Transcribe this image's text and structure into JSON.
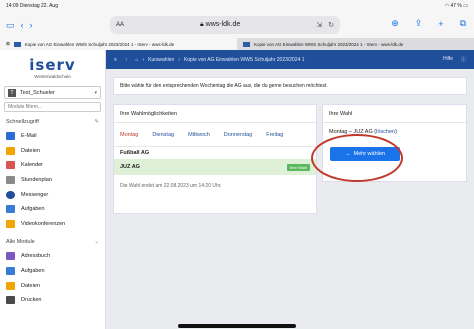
{
  "status": {
    "time_date": "14:09  Dienstag 22. Aug",
    "battery": "47 %"
  },
  "browser": {
    "reader": "AA",
    "url": "wws-ldk.de"
  },
  "tabs": [
    {
      "label": "Kopie von AG Einwahlen WWS Schuljahr 2023/2024 1 - IServ - wws-ldk.de"
    },
    {
      "label": "Kopie von AG Einwahlen WWS Schuljahr 2023/2024 1 - IServ - wws-ldk.de"
    }
  ],
  "sidebar": {
    "logo": "iserv",
    "school": "Westerwaldschule",
    "user_initial": "T",
    "user": "Test_Schueler",
    "search_placeholder": "Module filtern...",
    "quick_access": "Schnellzugriff",
    "items": [
      "E-Mail",
      "Dateien",
      "Kalender",
      "Stundenplan",
      "Messenger",
      "Aufgaben",
      "Videokonferenzen"
    ],
    "all_modules": "Alle Module",
    "modules": [
      "Adressbuch",
      "Aufgaben",
      "Dateien",
      "Drucken"
    ]
  },
  "header": {
    "breadcrumb": [
      "Kurswahlen",
      "Kopie von AG Einwahlen WWS Schuljahr 2023/2024 1"
    ],
    "help": "Hilfe"
  },
  "notice": "Bitte wähle für den entsprechenden Wochentag die AG aus, die du gerne besuchen möchtest.",
  "left_card": {
    "title": "Ihre Wahlmöglichkeiten",
    "days": [
      "Montag",
      "Dienstag",
      "Mittwoch",
      "Donnerstag",
      "Freitag"
    ],
    "group": "Fußball AG",
    "course": "JUZ AG",
    "course_badge": "Ihre Wahl",
    "end": "Die Wahl endet am 22.08.2023 um 14:20 Uhr."
  },
  "right_card": {
    "title": "Ihre Wahl",
    "day": "Montag",
    "choice": "JUZ AG",
    "delete": "löschen",
    "more_button": "Mehr wählen"
  },
  "colors": {
    "brand": "#1f4e9a",
    "accent": "#1a73e8",
    "active_day": "#c0392b",
    "highlight": "#c0392b"
  }
}
